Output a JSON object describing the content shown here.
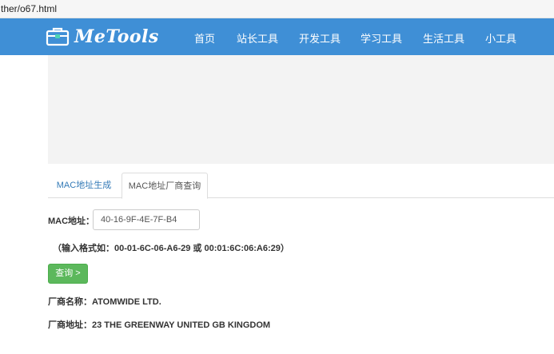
{
  "browser": {
    "url_fragment": "ther/o67.html"
  },
  "brand": {
    "name": "MeTools",
    "nav_color": "#3f8fd6"
  },
  "nav": {
    "items": [
      "首页",
      "站长工具",
      "开发工具",
      "学习工具",
      "生活工具",
      "小工具"
    ]
  },
  "tabs": {
    "items": [
      "MAC地址生成",
      "MAC地址厂商查询"
    ],
    "active_index": 1
  },
  "form": {
    "mac_label": "MAC地址：",
    "mac_value": "40-16-9F-4E-7F-B4",
    "hint": "（输入格式如：00-01-6C-06-A6-29 或 00:01:6C:06:A6:29）",
    "query_button": "查询 >",
    "button_color": "#5cb85c"
  },
  "result": {
    "vendor_name_line": "厂商名称：ATOMWIDE LTD.",
    "vendor_address_line": "厂商地址：23 THE GREENWAY UNITED GB KINGDOM"
  }
}
